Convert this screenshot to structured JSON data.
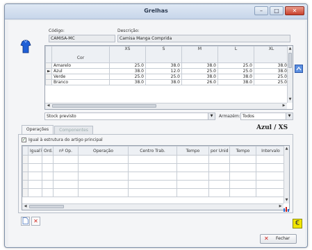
{
  "window": {
    "title": "Grelhas",
    "minimize_glyph": "–",
    "maximize_glyph": "□",
    "close_glyph": "✕"
  },
  "header": {
    "code_label": "Código:",
    "code_value": "CAMISA-MC",
    "description_label": "Descrição:",
    "description_value": "Camisa Manga Comprida"
  },
  "grid": {
    "color_header": "Cor",
    "size_headers": [
      "XS",
      "S",
      "M",
      "L",
      "XL"
    ],
    "rows": [
      {
        "marker": "",
        "color": "Amarelo",
        "values": [
          "25.0",
          "38.0",
          "38.0",
          "25.0",
          "38.0"
        ]
      },
      {
        "marker": "►",
        "color": "Azul",
        "values": [
          "38.0",
          "12.0",
          "25.0",
          "25.0",
          "38.0"
        ]
      },
      {
        "marker": "",
        "color": "Verde",
        "values": [
          "25.0",
          "25.0",
          "38.0",
          "38.0",
          "25.0"
        ]
      },
      {
        "marker": "",
        "color": "Branco",
        "values": [
          "38.0",
          "38.0",
          "26.0",
          "38.0",
          "25.0"
        ]
      }
    ]
  },
  "stock": {
    "mode_value": "Stock previsto",
    "warehouse_label": "Armazém:",
    "warehouse_value": "Todos"
  },
  "selection": {
    "title": "Azul / XS"
  },
  "tabs": [
    {
      "label": "Operações",
      "active": true
    },
    {
      "label": "Componentes",
      "active": false
    }
  ],
  "operations": {
    "same_structure_label": "Igual à estrutura do artigo principal",
    "same_structure_checked": true,
    "columns": [
      "Igual?",
      "Ord.",
      "nº Op.",
      "Operação",
      "Centro Trab.",
      "Tempo",
      "por Unid",
      "Tempo",
      "Intervalo"
    ]
  },
  "footer": {
    "close_label": "Fechar"
  },
  "colors": {
    "accent_blue": "#2f6fd0",
    "euro_yellow": "#f2e600",
    "delete_red": "#d0201a"
  }
}
